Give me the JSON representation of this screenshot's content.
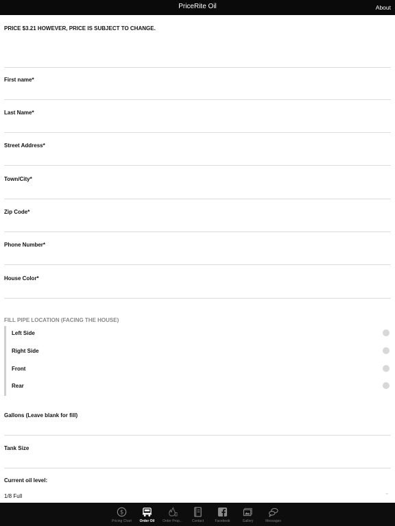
{
  "nav": {
    "title": "PriceRite Oil",
    "about": "About"
  },
  "form": {
    "price_notice": "PRICE $3.21 HOWEVER, PRICE IS SUBJECT TO CHANGE.",
    "fields": [
      {
        "label": "First name*"
      },
      {
        "label": "Last Name*"
      },
      {
        "label": "Street Address*"
      },
      {
        "label": "Town/City*"
      },
      {
        "label": "Zip Code*"
      },
      {
        "label": "Phone Number*"
      },
      {
        "label": "House Color*"
      }
    ],
    "fill_pipe": {
      "header": "FILL PIPE LOCATION (FACING THE HOUSE)",
      "options": [
        "Left Side",
        "Right Side",
        "Front",
        "Rear"
      ]
    },
    "gallons": {
      "label": "Gallons (Leave blank for fill)"
    },
    "tank_size": {
      "label": "Tank Size"
    },
    "oil_level": {
      "label": "Current oil level:",
      "value": "1/8 Full"
    }
  },
  "tabs": [
    {
      "label": "Pricing Chart",
      "icon": "dollar-icon"
    },
    {
      "label": "Order Oil",
      "icon": "truck-icon",
      "active": true
    },
    {
      "label": "Order Prop...",
      "icon": "flame-icon"
    },
    {
      "label": "Contact",
      "icon": "phonebook-icon"
    },
    {
      "label": "Facebook",
      "icon": "facebook-icon"
    },
    {
      "label": "Gallery",
      "icon": "gallery-icon"
    },
    {
      "label": "Messages",
      "icon": "messages-icon"
    }
  ]
}
